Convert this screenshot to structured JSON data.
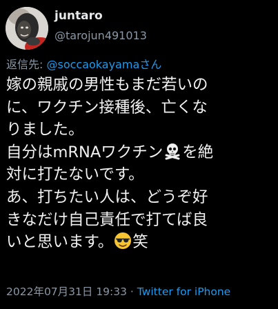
{
  "user": {
    "display_name": "juntaro",
    "handle": "@tarojun491013"
  },
  "reply": {
    "prefix": "返信先: ",
    "mention": "@soccaokayama",
    "suffix": "さん"
  },
  "body": {
    "line1": "嫁の親戚の男性もまだ若いの",
    "line2": "に、ワクチン接種後、亡くな",
    "line3": "りました。",
    "line4_a": "自分はmRNAワクチン",
    "line4_emoji": "skull-and-crossbones",
    "line4_b": "を絶",
    "line5": "対に打たないです。",
    "line6": "あ、打ちたい人は、どうぞ好",
    "line7": "きなだけ自己責任で打てば良",
    "line8_a": "いと思います。",
    "line8_emoji": "smiling-face-with-sunglasses",
    "line8_b": "笑"
  },
  "meta": {
    "datetime": "2022年07月31日 19:33",
    "separator": " · ",
    "source": "Twitter for iPhone"
  },
  "colors": {
    "background": "#000000",
    "text": "#e7e9ea",
    "secondary": "#8b98a5",
    "link": "#1d9bf0"
  }
}
